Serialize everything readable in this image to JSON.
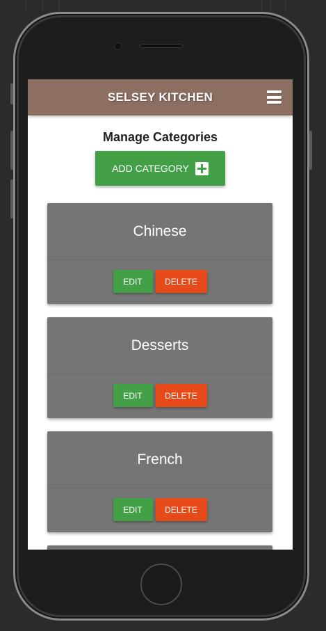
{
  "header": {
    "brand": "SELSEY KITCHEN"
  },
  "page": {
    "title": "Manage Categories",
    "add_label": "ADD CATEGORY"
  },
  "categories": [
    {
      "name": "Chinese",
      "edit_label": "EDIT",
      "delete_label": "DELETE"
    },
    {
      "name": "Desserts",
      "edit_label": "EDIT",
      "delete_label": "DELETE"
    },
    {
      "name": "French",
      "edit_label": "EDIT",
      "delete_label": "DELETE"
    },
    {
      "name": "",
      "edit_label": "",
      "delete_label": ""
    }
  ],
  "icons": {
    "menu": "hamburger-menu-icon",
    "add": "plus-square-icon"
  },
  "colors": {
    "navbar": "#8d6e63",
    "primary_green": "#43a047",
    "delete_orange": "#e64a19",
    "card_gray": "#757575"
  }
}
